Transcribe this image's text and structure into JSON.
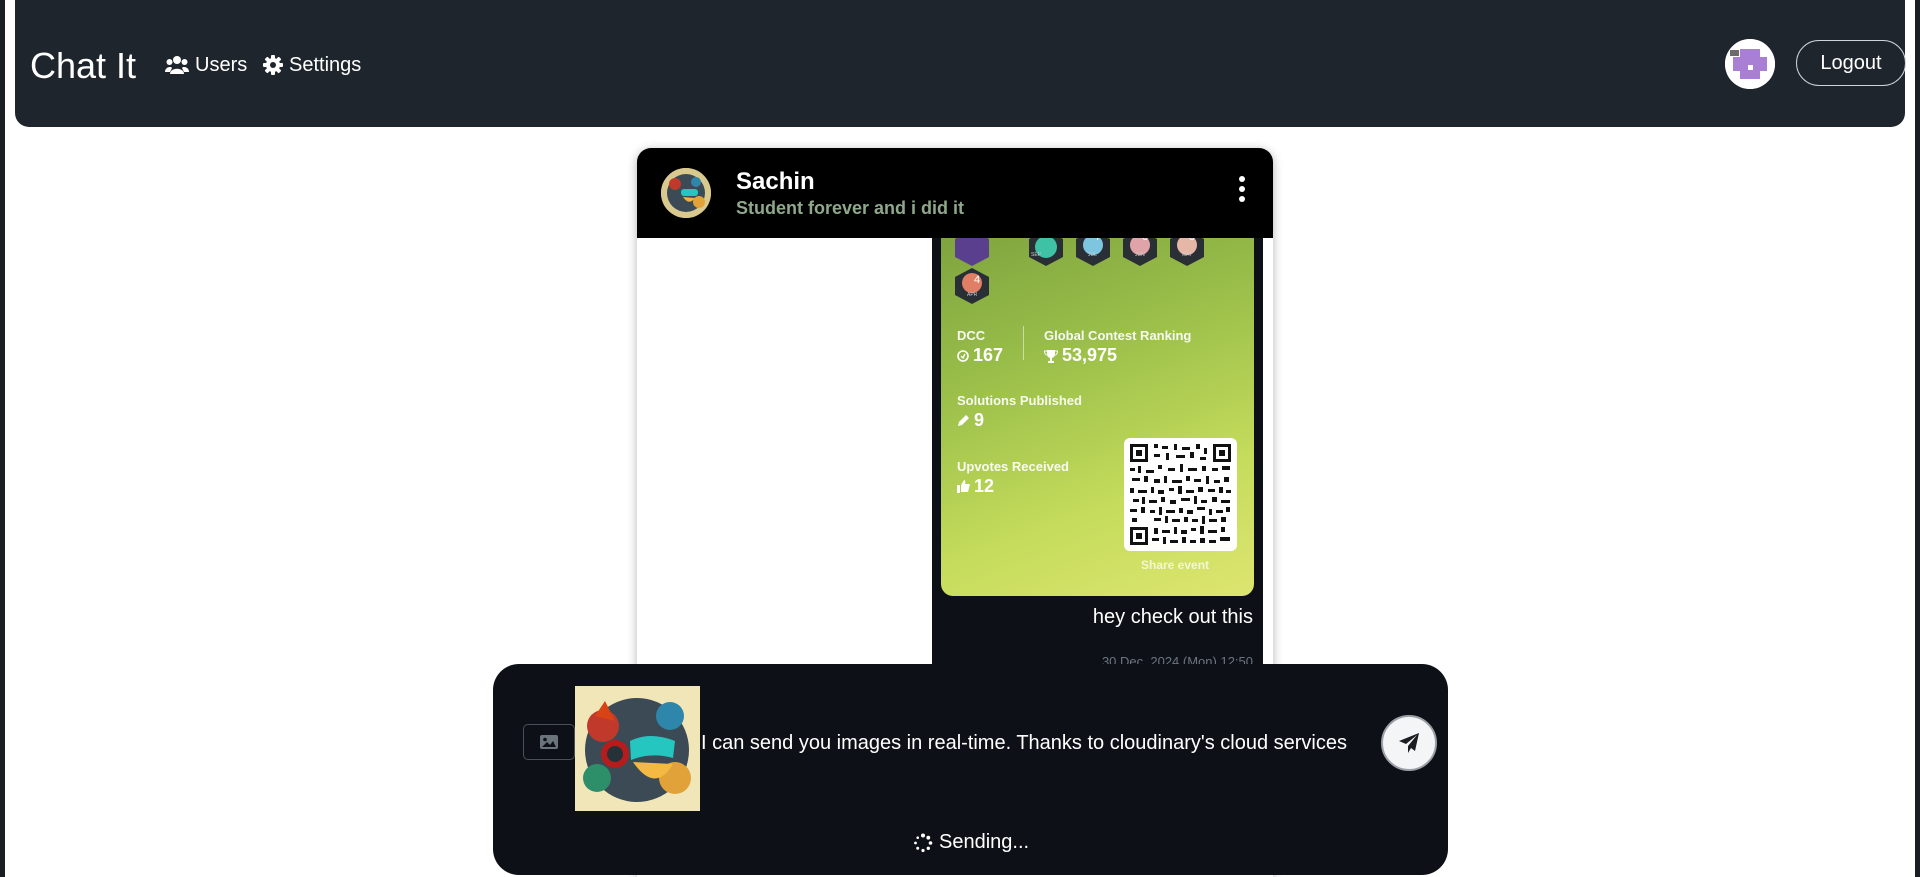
{
  "navbar": {
    "brand": "Chat It",
    "links": [
      {
        "label": "Users",
        "icon": "users-icon"
      },
      {
        "label": "Settings",
        "icon": "gear-icon"
      }
    ],
    "logout_label": "Logout"
  },
  "chat": {
    "contact": {
      "name": "Sachin",
      "status": "Student forever and i did it"
    },
    "message": {
      "card": {
        "badge_labels": [
          "SEP",
          "JUL",
          "JUN",
          "MAY",
          "APR"
        ],
        "badge_numbers": [
          "7",
          "6",
          "5",
          "4"
        ],
        "dcc_label": "DCC",
        "dcc_value": "167",
        "ranking_label": "Global Contest Ranking",
        "ranking_value": "53,975",
        "solutions_label": "Solutions Published",
        "solutions_value": "9",
        "upvotes_label": "Upvotes Received",
        "upvotes_value": "12",
        "share_label": "Share event"
      },
      "text": "hey check out this",
      "timestamp": "30 Dec, 2024 (Mon)     12:50"
    }
  },
  "composer": {
    "text": "I can send you images in real-time. Thanks to cloudinary's cloud services",
    "status": "Sending..."
  },
  "colors": {
    "navbar_bg": "#1f252c",
    "composer_bg": "#0d1117",
    "card_gradient_start": "#7fa43f",
    "card_gradient_end": "#dde570",
    "status_text": "#8fa88c"
  }
}
